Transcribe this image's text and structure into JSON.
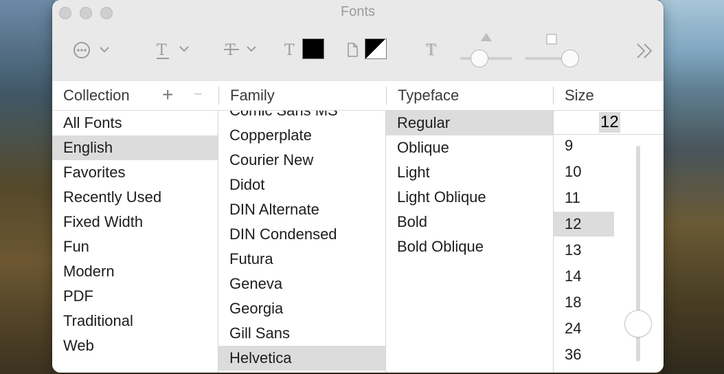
{
  "window": {
    "title": "Fonts"
  },
  "toolbar": {
    "action_icon": "ellipsis-circle-icon",
    "underline_icon": "T-underline-icon",
    "strike_icon": "T-strikethrough-icon",
    "text_color_icon": "T-icon",
    "text_color": "#000000",
    "doc_color_icon": "document-icon",
    "shadow_icon": "T-shadow-icon",
    "more_icon": "chevron-double-right-icon"
  },
  "headers": {
    "collection": "Collection",
    "family": "Family",
    "typeface": "Typeface",
    "size": "Size"
  },
  "collections": [
    "All Fonts",
    "English",
    "Favorites",
    "Recently Used",
    "Fixed Width",
    "Fun",
    "Modern",
    "PDF",
    "Traditional",
    "Web"
  ],
  "collections_selected": "English",
  "families": [
    "Comic Sans MS",
    "Copperplate",
    "Courier New",
    "Didot",
    "DIN Alternate",
    "DIN Condensed",
    "Futura",
    "Geneva",
    "Georgia",
    "Gill Sans",
    "Helvetica"
  ],
  "families_selected": "Helvetica",
  "typefaces": [
    "Regular",
    "Oblique",
    "Light",
    "Light Oblique",
    "Bold",
    "Bold Oblique"
  ],
  "typefaces_selected": "Regular",
  "size": {
    "value": "12",
    "options": [
      "9",
      "10",
      "11",
      "12",
      "13",
      "14",
      "18",
      "24",
      "36"
    ],
    "selected": "12"
  }
}
